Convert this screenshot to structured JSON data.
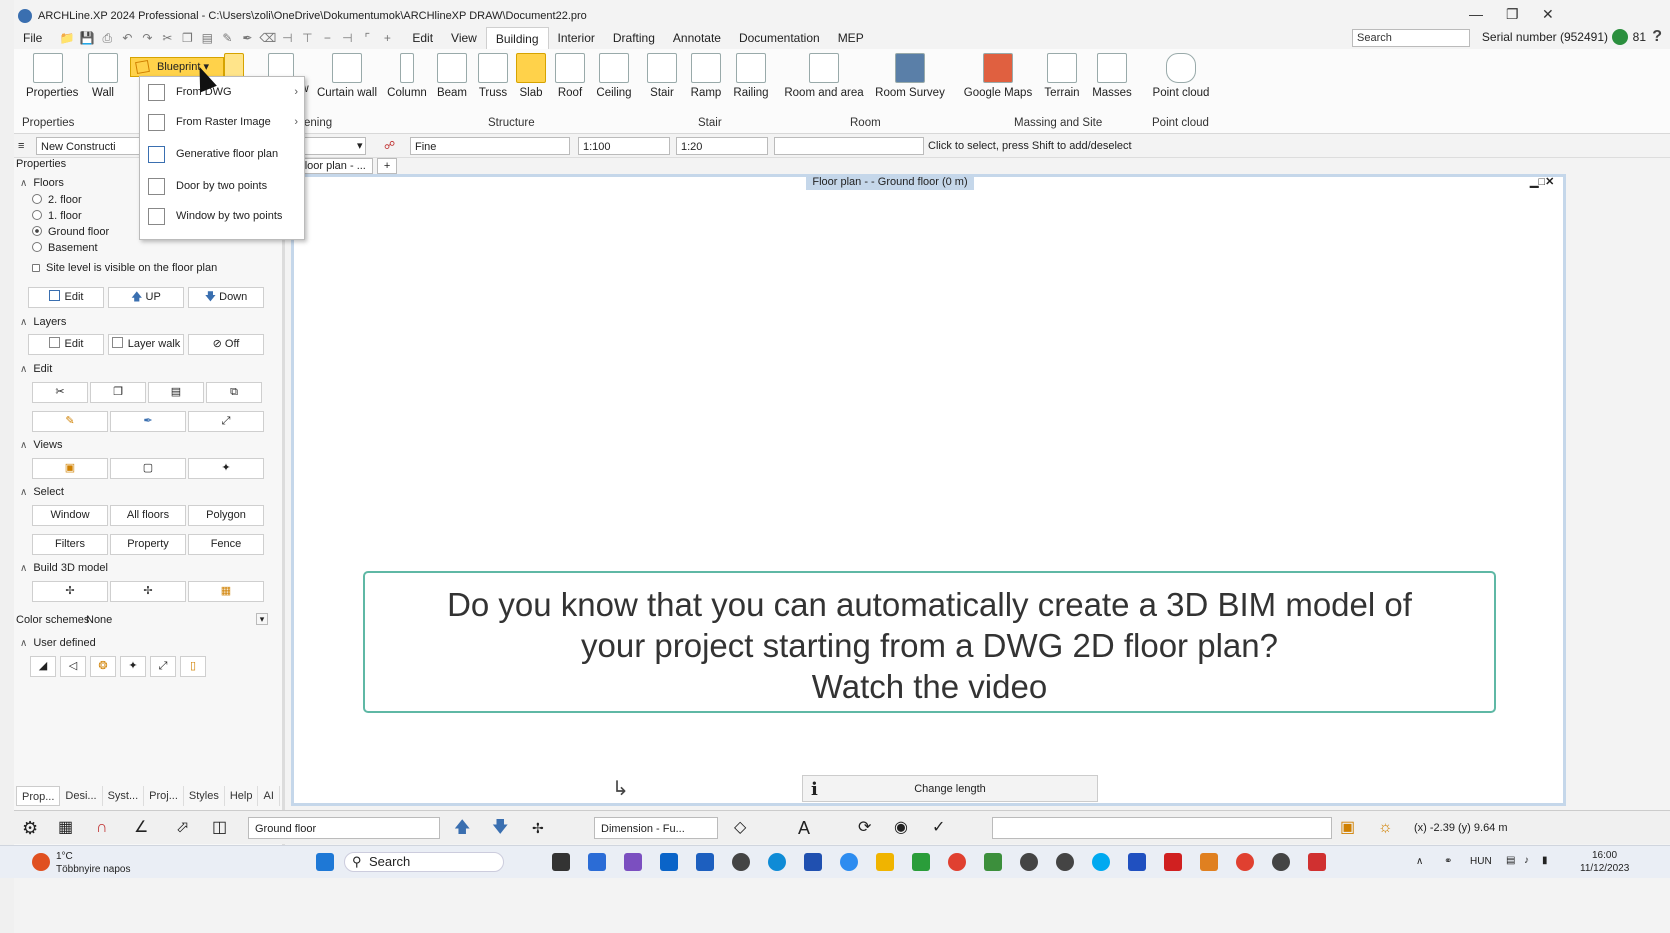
{
  "window": {
    "title": "ARCHLine.XP 2024 Professional - C:\\Users\\zoli\\OneDrive\\Dokumentumok\\ARCHlineXP DRAW\\Document22.pro"
  },
  "menu": {
    "file": "File",
    "items": [
      "Edit",
      "View",
      "Building",
      "Interior",
      "Drafting",
      "Annotate",
      "Documentation",
      "MEP"
    ],
    "active": "Building"
  },
  "header": {
    "search_placeholder": "Search",
    "serial": "Serial number (952491)",
    "count": "81"
  },
  "ribbon": {
    "properties": "Properties",
    "wall": "Wall",
    "blueprint": "Blueprint",
    "curtain_wall": "Curtain wall",
    "column": "Column",
    "beam": "Beam",
    "truss": "Truss",
    "slab": "Slab",
    "roof": "Roof",
    "ceiling": "Ceiling",
    "stair": "Stair",
    "ramp": "Ramp",
    "railing": "Railing",
    "room_area": "Room and area",
    "room_survey": "Room Survey",
    "google_maps": "Google Maps",
    "terrain": "Terrain",
    "masses": "Masses",
    "point_cloud": "Point cloud",
    "frag_ow": "ow",
    "groups": {
      "properties": "Properties",
      "opening": "ening",
      "structure": "Structure",
      "stair": "Stair",
      "room": "Room",
      "massing": "Massing and Site",
      "point_cloud": "Point cloud"
    }
  },
  "blueprint_menu": {
    "items": [
      "From DWG",
      "From Raster Image",
      "Generative floor plan",
      "Door by two points",
      "Window by two points"
    ]
  },
  "toolbar2": {
    "construction": "New Constructi",
    "fine": "Fine",
    "scale": "1:100",
    "line": "1:20",
    "hint": "Click to select, press Shift to add/deselect"
  },
  "panel": {
    "title": "Properties",
    "floors_label": "Floors",
    "floors": [
      "2. floor",
      "1. floor",
      "Ground floor",
      "Basement"
    ],
    "site_level": "Site level is visible on the floor plan",
    "edit": "Edit",
    "up": "UP",
    "down": "Down",
    "layers_label": "Layers",
    "layers_edit": "Edit",
    "layer_walk": "Layer walk",
    "off": "Off",
    "edit_label": "Edit",
    "views_label": "Views",
    "select_label": "Select",
    "window": "Window",
    "all_floors": "All floors",
    "polygon": "Polygon",
    "filters": "Filters",
    "property": "Property",
    "fence": "Fence",
    "build3d_label": "Build 3D model",
    "color_schemes": "Color schemes",
    "color_value": "None",
    "user_defined": "User defined",
    "tabs": [
      "Prop...",
      "Desi...",
      "Syst...",
      "Proj...",
      "Styles",
      "Help",
      "AI"
    ]
  },
  "canvas": {
    "tab": "Floor plan - ...",
    "add_tab": "+",
    "title": "Floor plan -  - Ground floor (0 m)"
  },
  "banner": {
    "line1": "Do you know that you can automatically create a 3D BIM model of",
    "line2": "your project starting from a DWG 2D floor plan?",
    "line3": "Watch the video"
  },
  "change_length": "Change length",
  "bottom": {
    "floor": "Ground floor",
    "dimension": "Dimension - Fu...",
    "coords": "(x) -2.39  (y) 9.64 m"
  },
  "taskbar": {
    "temp": "1°C",
    "weather": "Többnyire napos",
    "search": "Search",
    "lang": "HUN",
    "time": "16:00",
    "date": "11/12/2023"
  }
}
